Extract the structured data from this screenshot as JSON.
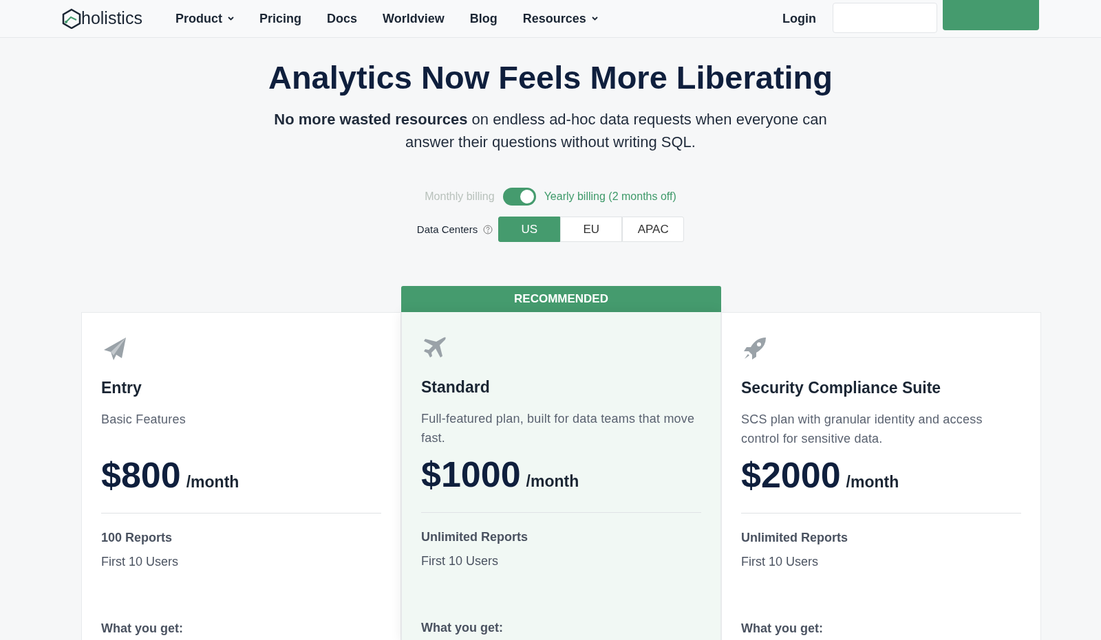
{
  "nav": {
    "logo": "holistics",
    "items": [
      {
        "label": "Product",
        "dropdown": true
      },
      {
        "label": "Pricing",
        "dropdown": false
      },
      {
        "label": "Docs",
        "dropdown": false
      },
      {
        "label": "Worldview",
        "dropdown": false
      },
      {
        "label": "Blog",
        "dropdown": false
      },
      {
        "label": "Resources",
        "dropdown": true
      }
    ],
    "login": "Login"
  },
  "hero": {
    "title": "Analytics Now Feels More Liberating",
    "subtitle": "**No more wasted resources** on endless ad-hoc data requests when everyone can answer their questions without writing SQL."
  },
  "billing": {
    "monthly_label": "Monthly billing",
    "yearly_label": "Yearly billing (2 months off)",
    "on": true
  },
  "data_centers": {
    "label": "Data Centers",
    "options": [
      {
        "label": "US",
        "selected": true
      },
      {
        "label": "EU",
        "selected": false
      },
      {
        "label": "APAC",
        "selected": false
      }
    ]
  },
  "plans": [
    {
      "kind": "paper-plane",
      "name": "Entry",
      "description": "Basic Features",
      "price": "$800",
      "period": "/month",
      "reports": "100 Reports",
      "users": "First 10 Users",
      "what": "What you get:",
      "recommended": false
    },
    {
      "kind": "airplane",
      "name": "Standard",
      "description": "Full-featured plan, built for data teams that move fast.",
      "price": "$1000",
      "period": "/month",
      "reports": "Unlimited Reports",
      "users": "First 10 Users",
      "what": "What you get:",
      "recommended": true,
      "badge": "RECOMMENDED"
    },
    {
      "kind": "rocket",
      "name": "Security Compliance Suite",
      "description": "SCS plan with granular identity and access control for sensitive data.",
      "price": "$2000",
      "period": "/month",
      "reports": "Unlimited Reports",
      "users": "First 10 Users",
      "what": "What you get:",
      "recommended": false
    }
  ]
}
